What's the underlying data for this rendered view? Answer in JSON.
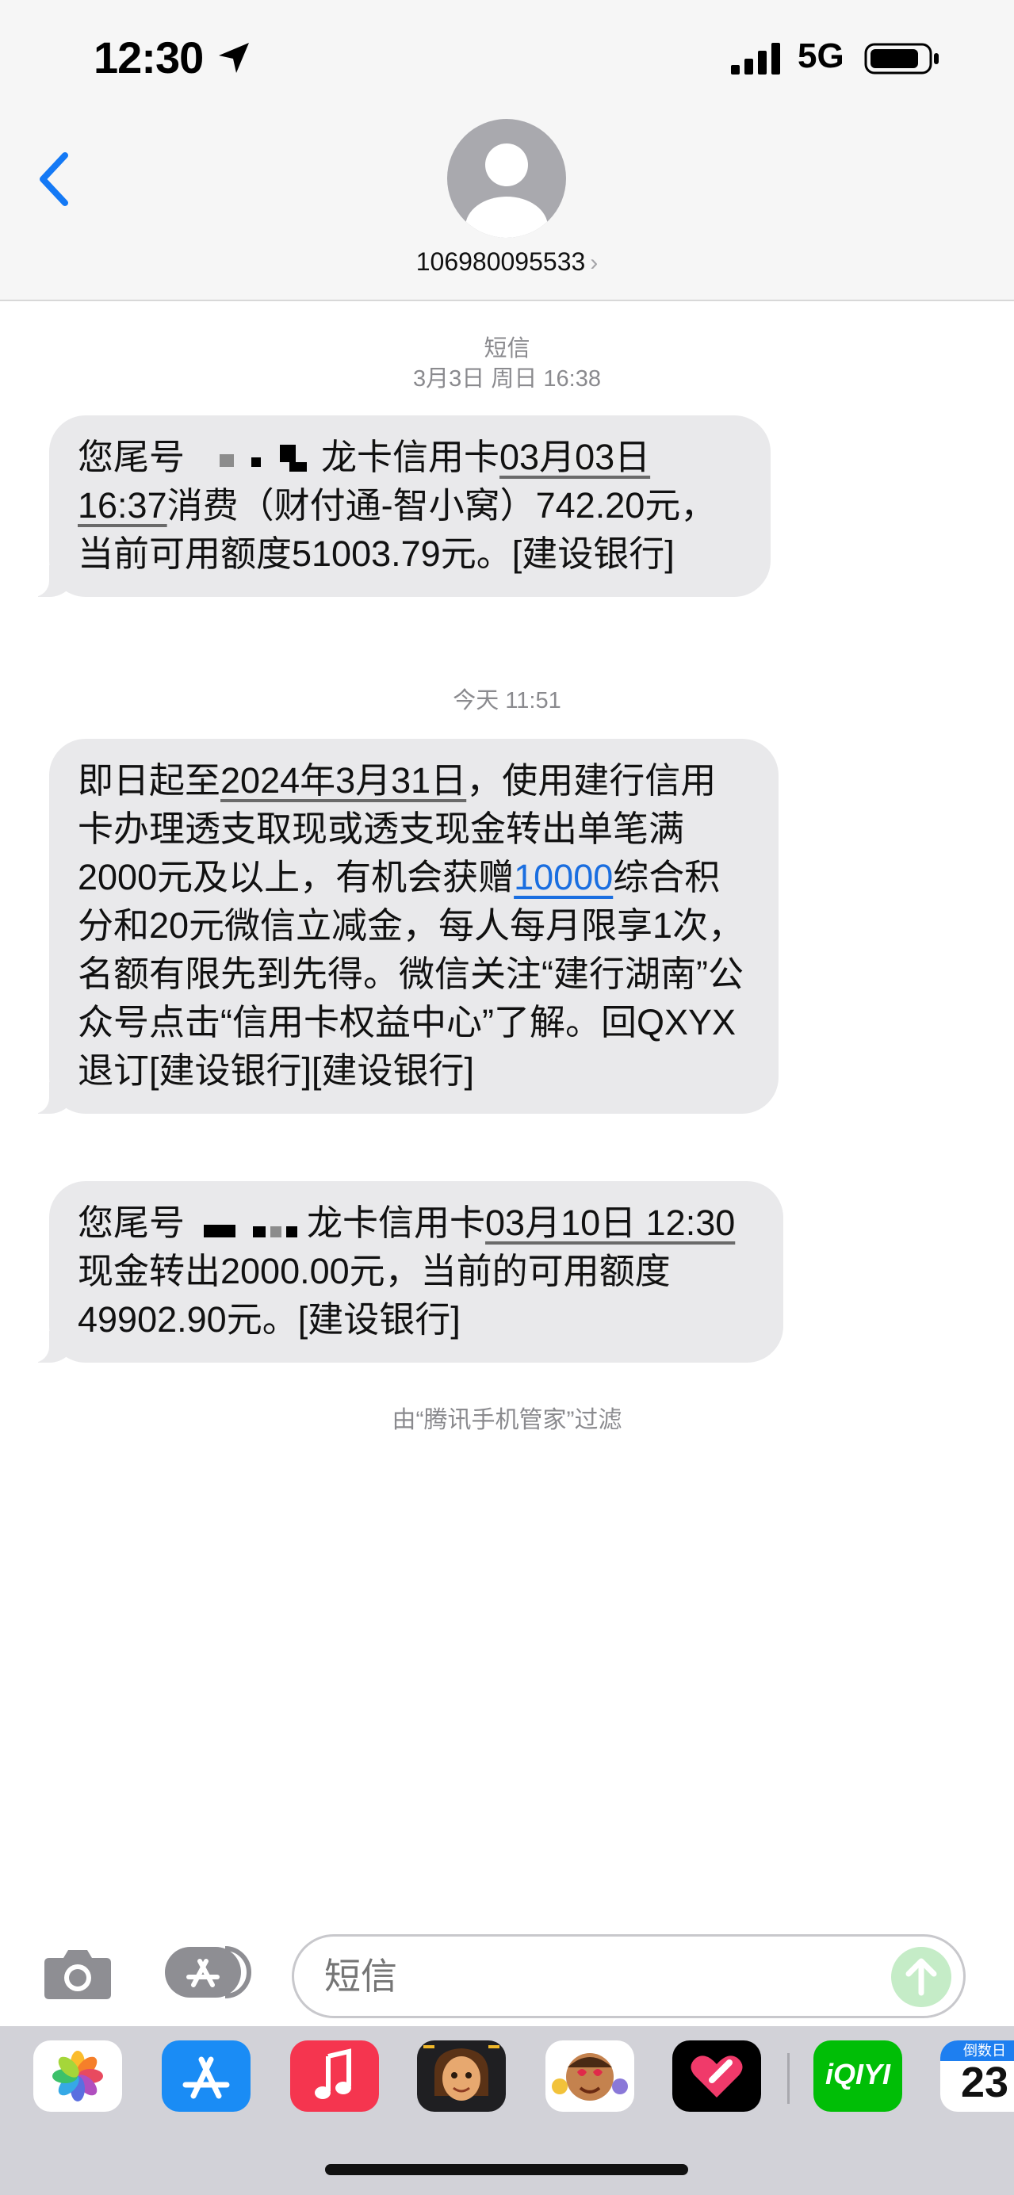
{
  "status_bar": {
    "time": "12:30",
    "network": "5G"
  },
  "header": {
    "contact": "106980095533",
    "contact_chevron": "›"
  },
  "conversation": {
    "timestamp_1_type": "短信",
    "timestamp_1_date": "3月3日 周日 16:38",
    "message_1": {
      "prefix": "您尾号",
      "part_a": "龙卡信用卡",
      "date": "03月03日 16:37",
      "part_b": "消费（财付通-智小窝）742.20元，当前可用额度51003.79元。[建设银行]"
    },
    "timestamp_2": "今天 11:51",
    "message_2": {
      "part_a": "即日起至",
      "date": "2024年3月31日",
      "part_b": "，使用建行信用卡办理透支取现或透支现金转出单笔满2000元及以上，有机会获赠",
      "link": "10000",
      "part_c": "综合积分和20元微信立减金，每人每月限享1次，名额有限先到先得。微信关注“建行湖南”公众号点击“信用卡权益中心”了解。回QXYX退订[建设银行][建设银行]"
    },
    "message_3": {
      "prefix": "您尾号",
      "part_a": "龙卡信用卡",
      "date": "03月10日 12:30",
      "part_b": "现金转出2000.00元，当前的可用额度49902.90元。[建设银行]"
    },
    "filter_note": "由“腾讯手机管家”过滤"
  },
  "input_bar": {
    "placeholder": "短信"
  },
  "app_drawer": {
    "iqiyi_label": "iQIYI",
    "calendar_header": "倒数日",
    "calendar_number": "23"
  },
  "colors": {
    "bubble": "#e9e9eb",
    "link": "#1a6ee0",
    "ios_blue": "#1479f5",
    "send_button": "#c5ecc7"
  }
}
